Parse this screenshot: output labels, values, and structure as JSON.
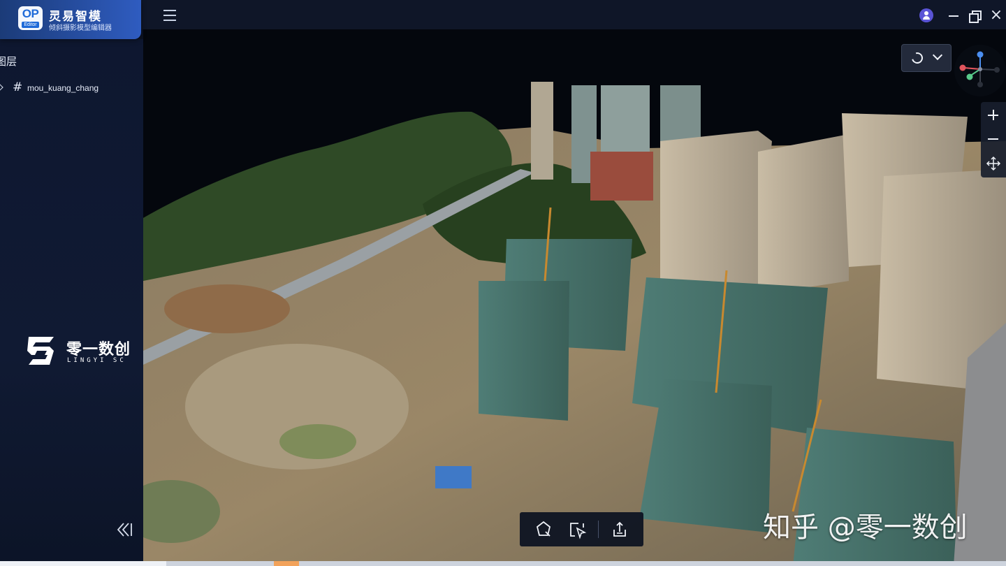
{
  "app": {
    "logo_text": "OP",
    "logo_sub": "Editor",
    "name": "灵易智模",
    "subtitle": "倾斜摄影模型编辑器"
  },
  "layer_panel": {
    "title": "图层",
    "layers": [
      {
        "icon": "hash-icon",
        "name": "mou_kuang_chang",
        "expanded": false
      }
    ]
  },
  "company": {
    "name_cn": "零一数创",
    "name_en": "LINGYI SC"
  },
  "viewport": {
    "view_mode_icon": "orbit-icon",
    "navigation": [
      "zoom-in",
      "zoom-out",
      "pan"
    ],
    "toolbar": [
      "polygon-select",
      "pointer-select",
      "export"
    ]
  },
  "watermark": "知乎 @零一数创",
  "colors": {
    "brand_blue": "#2f5cc0",
    "logo_blue": "#1f6ad8",
    "avatar": "#5a54d6",
    "sidebar_bg": "#101a33"
  }
}
